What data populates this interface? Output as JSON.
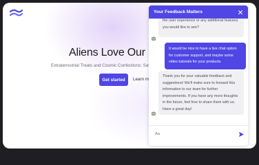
{
  "page": {
    "hero_title": "Aliens Love Our C",
    "hero_subtitle": "Extraterrestrial Treats and Cosmic Confections: Savor",
    "primary_button": "Get started",
    "secondary_link": "Learn m"
  },
  "chat": {
    "title": "Your Feedback Matters",
    "close_icon": "close-icon",
    "messages": [
      {
        "role": "bot",
        "text": "the user experience or any additional features you would like to see?"
      },
      {
        "role": "user",
        "text": "It would be nice to have a live chat option for customer support, and maybe some video tutorials for your products."
      },
      {
        "role": "bot",
        "text": "Thank you for your valuable feedback and suggestions! We'll make sure to forward this information to our team for further improvements. If you have any more thoughts in the future, feel free to share them with us. Have a great day!"
      }
    ],
    "input_value": "Aa",
    "send_icon": "send-icon"
  },
  "colors": {
    "accent": "#4f46e5",
    "bot_bubble": "#f0f0f3",
    "frame": "#1f1f23"
  }
}
